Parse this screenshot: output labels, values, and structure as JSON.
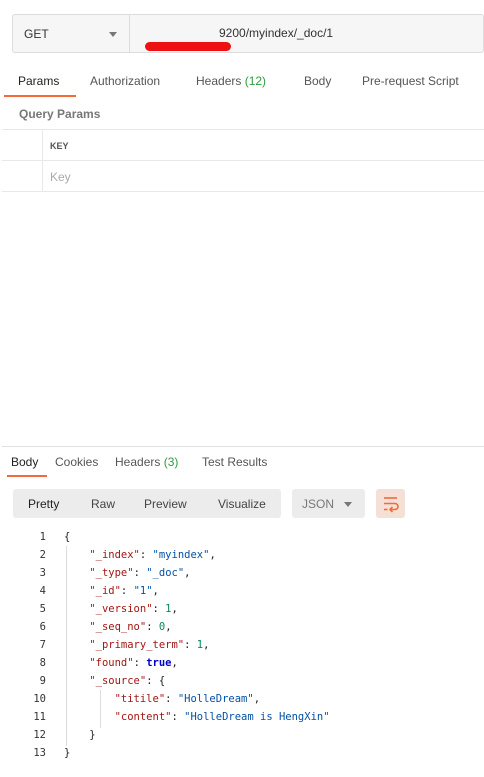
{
  "request": {
    "method": "GET",
    "url": "9200/myindex/_doc/1"
  },
  "request_tabs": [
    {
      "label": "Params"
    },
    {
      "label": "Authorization"
    },
    {
      "label": "Headers",
      "count": "(12)"
    },
    {
      "label": "Body"
    },
    {
      "label": "Pre-request Script"
    }
  ],
  "query_params": {
    "title": "Query Params",
    "key_header": "KEY",
    "key_placeholder": "Key"
  },
  "response_tabs": [
    {
      "label": "Body"
    },
    {
      "label": "Cookies"
    },
    {
      "label": "Headers",
      "count": "(3)"
    },
    {
      "label": "Test Results"
    }
  ],
  "view_modes": [
    "Pretty",
    "Raw",
    "Preview",
    "Visualize"
  ],
  "format": "JSON",
  "line_numbers": [
    "1",
    "2",
    "3",
    "4",
    "5",
    "6",
    "7",
    "8",
    "9",
    "10",
    "11",
    "12",
    "13"
  ],
  "response_body": {
    "_index": "myindex",
    "_type": "_doc",
    "_id": "1",
    "_version": "1",
    "_seq_no": "0",
    "_primary_term": "1",
    "found": "true",
    "titile": "HolleDream",
    "content": "HolleDream is HengXin"
  },
  "colors": {
    "accent": "#f26b3a",
    "count_green": "#2e9b3f",
    "redaction": "#ee1111"
  }
}
